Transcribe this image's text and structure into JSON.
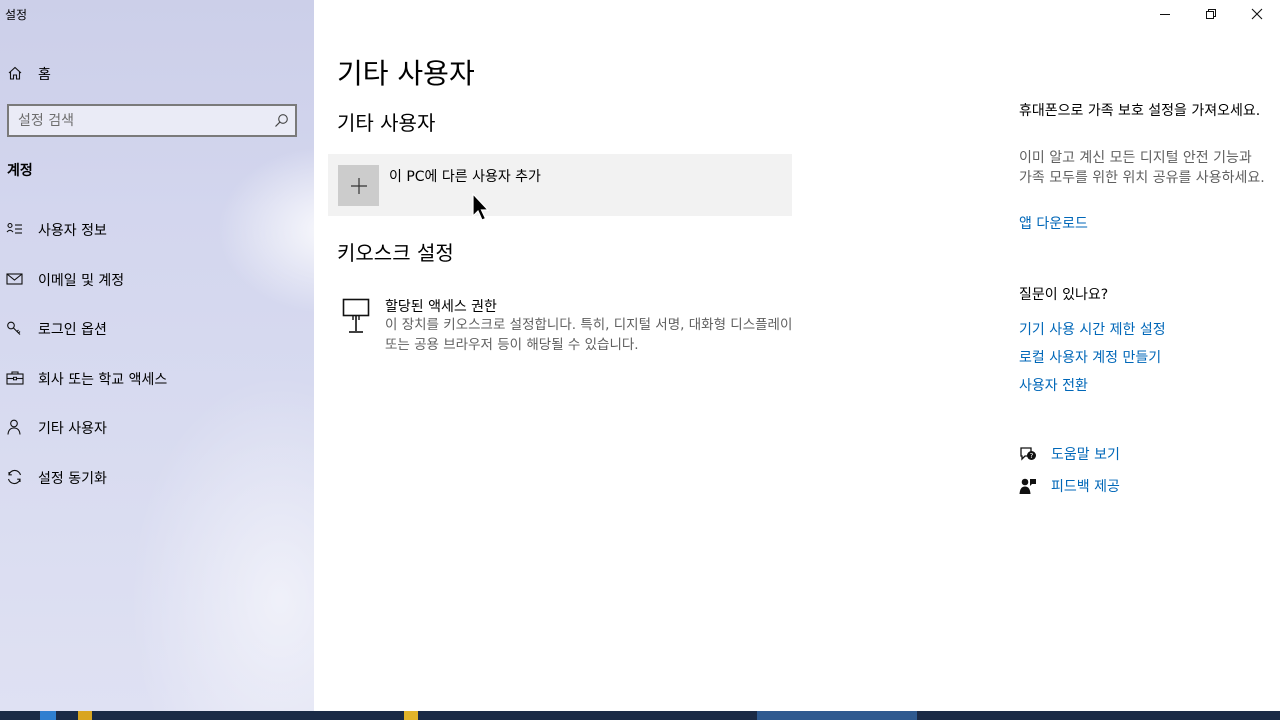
{
  "app": {
    "title": "설정"
  },
  "sidebar": {
    "home_label": "홈",
    "search_placeholder": "설정 검색",
    "section": "계정",
    "items": [
      {
        "label": "사용자 정보",
        "icon": "user-info-icon"
      },
      {
        "label": "이메일 및 계정",
        "icon": "mail-icon"
      },
      {
        "label": "로그인 옵션",
        "icon": "key-icon"
      },
      {
        "label": "회사 또는 학교 액세스",
        "icon": "briefcase-icon"
      },
      {
        "label": "기타 사용자",
        "icon": "person-icon"
      },
      {
        "label": "설정 동기화",
        "icon": "sync-icon"
      }
    ]
  },
  "main": {
    "title": "기타 사용자",
    "other_users_heading": "기타 사용자",
    "add_user_label": "이 PC에 다른 사용자 추가",
    "kiosk_heading": "키오스크 설정",
    "kiosk": {
      "title": "할당된 액세스 권한",
      "description": "이 장치를 키오스크로 설정합니다. 특히, 디지털 서명, 대화형 디스플레이 또는 공용 브라우저 등이 해당될 수 있습니다."
    }
  },
  "right_panel": {
    "promo_title": "휴대폰으로 가족 보호 설정을 가져오세요.",
    "promo_desc": "이미 알고 계신 모든 디지털 안전 기능과 가족 모두를 위한 위치 공유를 사용하세요.",
    "app_download": "앱 다운로드",
    "question": "질문이 있나요?",
    "links": [
      "기기 사용 시간 제한 설정",
      "로컬 사용자 계정 만들기",
      "사용자 전환"
    ],
    "help_label": "도움말 보기",
    "feedback_label": "피드백 제공"
  },
  "colors": {
    "accent_link": "#0067b8",
    "sidebar_bg": "#d3d6ee",
    "taskbar": "#1b2b46"
  }
}
